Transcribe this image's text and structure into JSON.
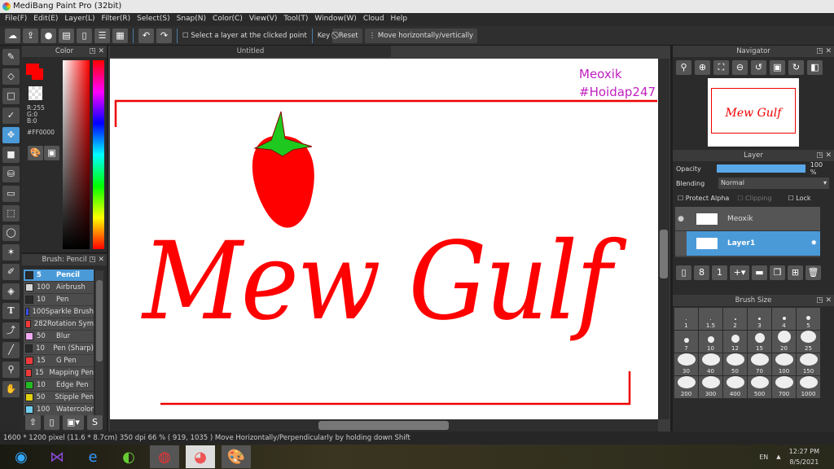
{
  "title": "MediBang Paint Pro (32bit)",
  "menu": [
    "File(F)",
    "Edit(E)",
    "Layer(L)",
    "Filter(R)",
    "Select(S)",
    "Snap(N)",
    "Color(C)",
    "View(V)",
    "Tool(T)",
    "Window(W)",
    "Cloud",
    "Help"
  ],
  "toolbar": {
    "select_layer_label": "Select a layer at the clicked point",
    "key_label": "Key",
    "reset_label": "Reset",
    "move_label": "Move horizontally/vertically"
  },
  "color": {
    "title": "Color",
    "r": "R:255",
    "g": "G:0",
    "b": "B:0",
    "hex": "#FF0000",
    "primary": "#ff0000"
  },
  "brush": {
    "title": "Brush: Pencil",
    "items": [
      {
        "size": "5",
        "name": "Pencil",
        "color": "#2a2a2a"
      },
      {
        "size": "100",
        "name": "Airbrush",
        "color": "#d8d8d8"
      },
      {
        "size": "10",
        "name": "Pen",
        "color": "#2a2a2a"
      },
      {
        "size": "100",
        "name": "Sparkle Brush",
        "color": "#3b4ef0"
      },
      {
        "size": "282",
        "name": "Rotation Sym",
        "color": "#f03a3a"
      },
      {
        "size": "50",
        "name": "Blur",
        "color": "#f0a8f0"
      },
      {
        "size": "10",
        "name": "Pen (Sharp)",
        "color": "#2a2a2a"
      },
      {
        "size": "15",
        "name": "G Pen",
        "color": "#f03a3a"
      },
      {
        "size": "15",
        "name": "Mapping Pen",
        "color": "#f03a3a"
      },
      {
        "size": "10",
        "name": "Edge Pen",
        "color": "#22bb22"
      },
      {
        "size": "50",
        "name": "Stipple Pen",
        "color": "#e0d010"
      },
      {
        "size": "100",
        "name": "Watercolor",
        "color": "#70d0f0"
      }
    ]
  },
  "document": {
    "tab": "Untitled",
    "watermark1": "Meoxik",
    "watermark2": "#Hoidap247",
    "art_text": "Mew Gulf"
  },
  "navigator": {
    "title": "Navigator"
  },
  "layer": {
    "title": "Layer",
    "opacity_label": "Opacity",
    "opacity_value": "100 %",
    "opacity": 100,
    "blending_label": "Blending",
    "blending_value": "Normal",
    "protect_alpha": "Protect Alpha",
    "clipping": "Clipping",
    "lock": "Lock",
    "layers": [
      {
        "name": "Meoxik",
        "selected": false
      },
      {
        "name": "Layer1",
        "selected": true
      }
    ]
  },
  "brush_size": {
    "title": "Brush Size",
    "sizes": [
      "1",
      "1.5",
      "2",
      "3",
      "4",
      "5",
      "7",
      "10",
      "12",
      "15",
      "20",
      "25",
      "30",
      "40",
      "50",
      "70",
      "100",
      "150",
      "200",
      "300",
      "400",
      "500",
      "700",
      "1000"
    ]
  },
  "status": "1600 * 1200 pixel   (11.6 * 8.7cm)   350 dpi   66 %   ( 919, 1035 )   Move Horizontally/Perpendicularly by holding down Shift",
  "taskbar": {
    "lang": "EN",
    "time": "12:27 PM",
    "date": "8/5/2021"
  }
}
